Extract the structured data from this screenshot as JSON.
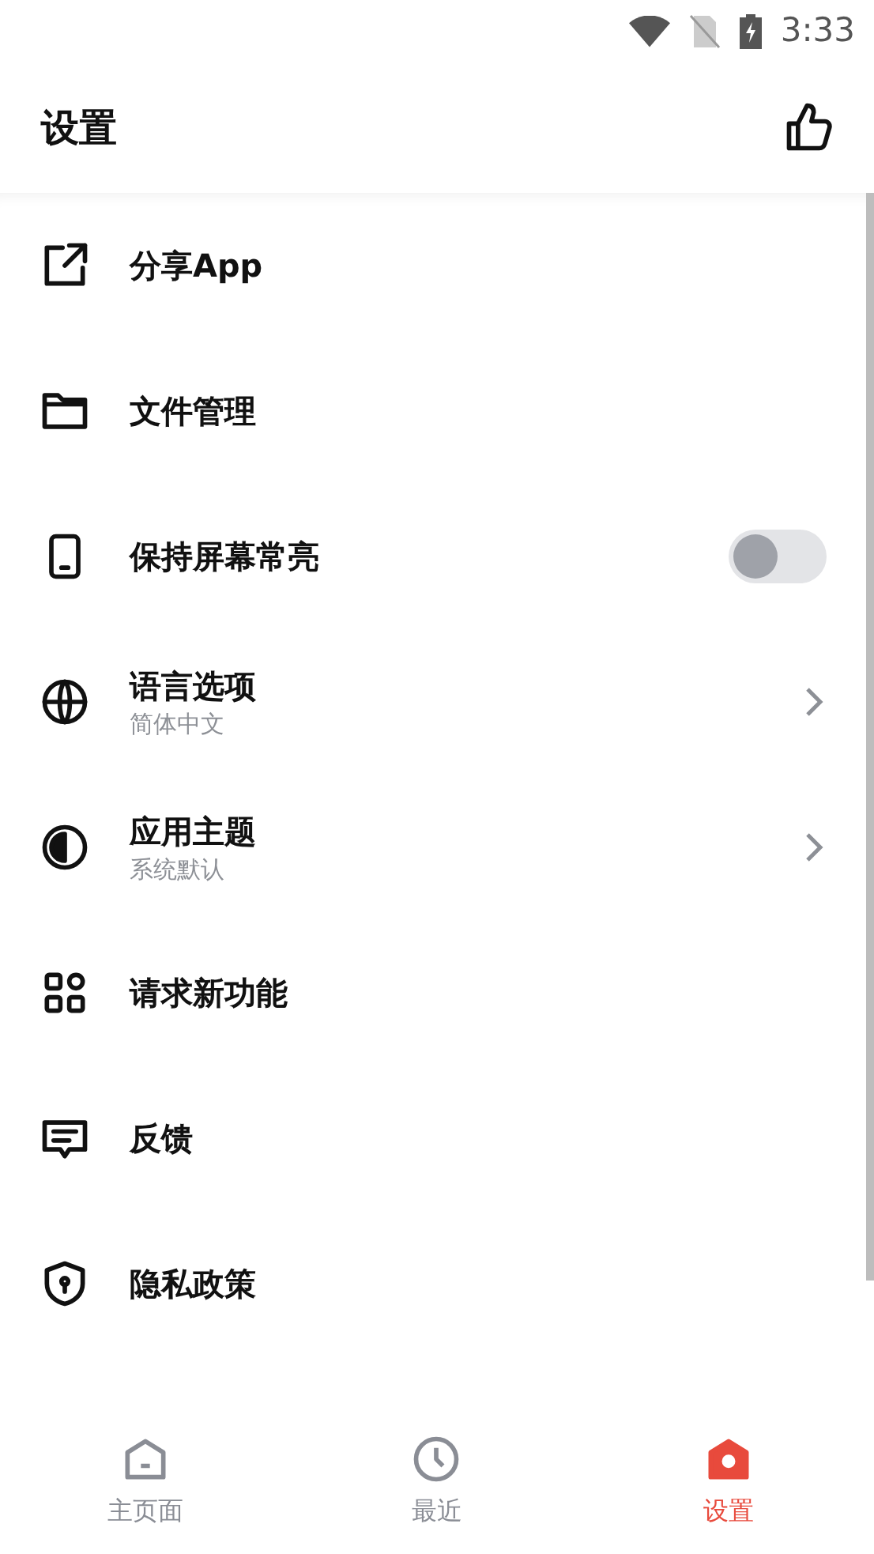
{
  "status_bar": {
    "time": "3:33"
  },
  "header": {
    "title": "设置"
  },
  "settings": [
    {
      "kind": "plain",
      "label": "分享App"
    },
    {
      "kind": "plain",
      "label": "文件管理"
    },
    {
      "kind": "toggle",
      "label": "保持屏幕常亮",
      "on": false
    },
    {
      "kind": "link",
      "label": "语言选项",
      "value": "简体中文"
    },
    {
      "kind": "link",
      "label": "应用主题",
      "value": "系统默认"
    },
    {
      "kind": "plain",
      "label": "请求新功能"
    },
    {
      "kind": "plain",
      "label": "反馈"
    },
    {
      "kind": "plain",
      "label": "隐私政策"
    }
  ],
  "bottom_nav": [
    {
      "label": "主页面",
      "selected": false
    },
    {
      "label": "最近",
      "selected": false
    },
    {
      "label": "设置",
      "selected": true
    }
  ]
}
